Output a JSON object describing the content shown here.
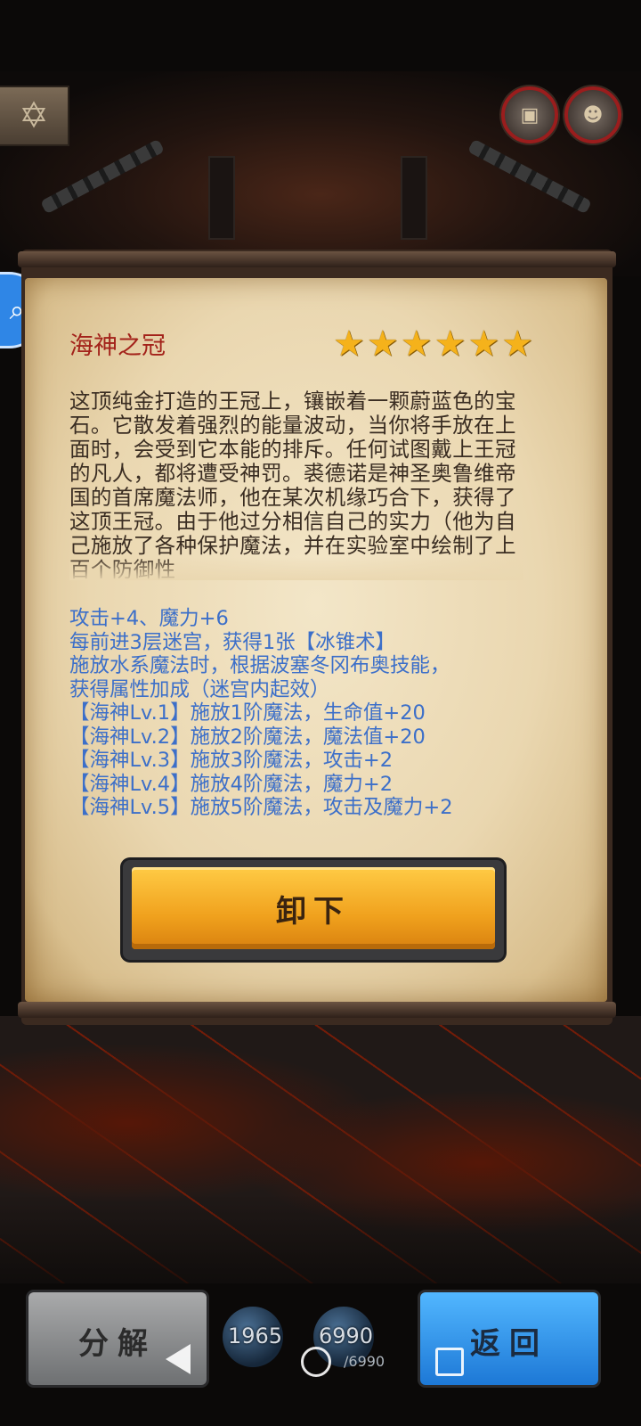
{
  "item": {
    "name": "海神之冠",
    "rating_stars": 6,
    "description": "这顶纯金打造的王冠上，镶嵌着一颗蔚蓝色的宝石。它散发着强烈的能量波动，当你将手放在上面时，会受到它本能的排斥。任何试图戴上王冠的凡人，都将遭受神罚。裘德诺是神圣奥鲁维帝国的首席魔法师，他在某次机缘巧合下，获得了这顶王冠。由于他过分相信自己的实力（他为自己施放了各种保护魔法，并在实验室中绘制了上百个防御性"
  },
  "effects": [
    "攻击+4、魔力+6",
    "每前进3层迷宫，获得1张【冰锥术】",
    "施放水系魔法时，根据波塞冬冈布奥技能，",
    "获得属性加成（迷宫内起效）",
    "【海神Lv.1】施放1阶魔法，生命值+20",
    "【海神Lv.2】施放2阶魔法，魔法值+20",
    "【海神Lv.3】施放3阶魔法，攻击+2",
    "【海神Lv.4】施放4阶魔法，魔力+2",
    "【海神Lv.5】施放5阶魔法，攻击及魔力+2"
  ],
  "buttons": {
    "unequip": "卸下",
    "decompose": "分解",
    "back": "返回"
  },
  "resources": {
    "orb1_value": "1965",
    "orb2_value": "6990",
    "orb2_max": "/6990"
  },
  "icons": {
    "corner": "hexagram-icon",
    "top_right_1": "chest-icon",
    "top_right_2": "merchant-icon",
    "side": "search-icon"
  },
  "colors": {
    "item_name": "#a3221a",
    "effect_text": "#3c6fc9",
    "star": "#f5b21b",
    "unequip_button": "#f0a11d",
    "back_button": "#1d78d6"
  }
}
